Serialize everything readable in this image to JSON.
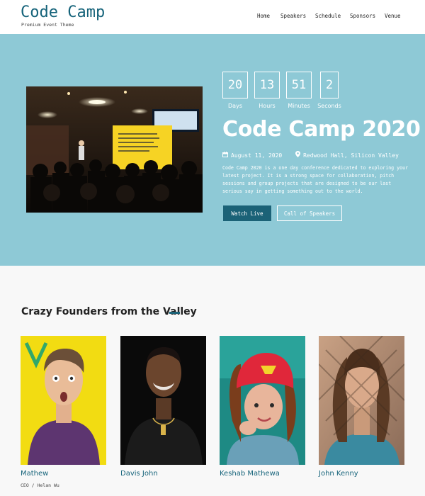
{
  "brand": {
    "name": "Code Camp",
    "tagline": "Premium Event Theme"
  },
  "nav": {
    "items": [
      "Home",
      "Speakers",
      "Schedule",
      "Sponsors",
      "Venue"
    ]
  },
  "countdown": [
    {
      "value": "20",
      "label": "Days"
    },
    {
      "value": "13",
      "label": "Hours"
    },
    {
      "value": "51",
      "label": "Minutes"
    },
    {
      "value": "2",
      "label": "Seconds"
    }
  ],
  "event": {
    "title": "Code Camp 2020",
    "date": "August 11, 2020",
    "location": "Redwood Hall, Silicon Valley",
    "description": "Code Camp 2020 is a one day conference dedicated to exploring your latest project. It is a strong space for collaboration, pitch sessions and group projects that are designed to be our last serious say in getting something out to the world.",
    "watch_label": "Watch Live",
    "cfs_label": "Call of Speakers"
  },
  "founders": {
    "title": "Crazy Founders from the Valley",
    "people": [
      {
        "name": "Mathew",
        "role": "CEO / Helan Wu"
      },
      {
        "name": "Davis John",
        "role": ""
      },
      {
        "name": "Keshab Mathewa",
        "role": ""
      },
      {
        "name": "John Kenny",
        "role": ""
      }
    ]
  },
  "colors": {
    "brand": "#15637a",
    "hero_bg": "#8ec9d6",
    "button": "#1b6277"
  },
  "icons": {
    "date": "calendar-icon",
    "location": "map-marker-icon"
  }
}
